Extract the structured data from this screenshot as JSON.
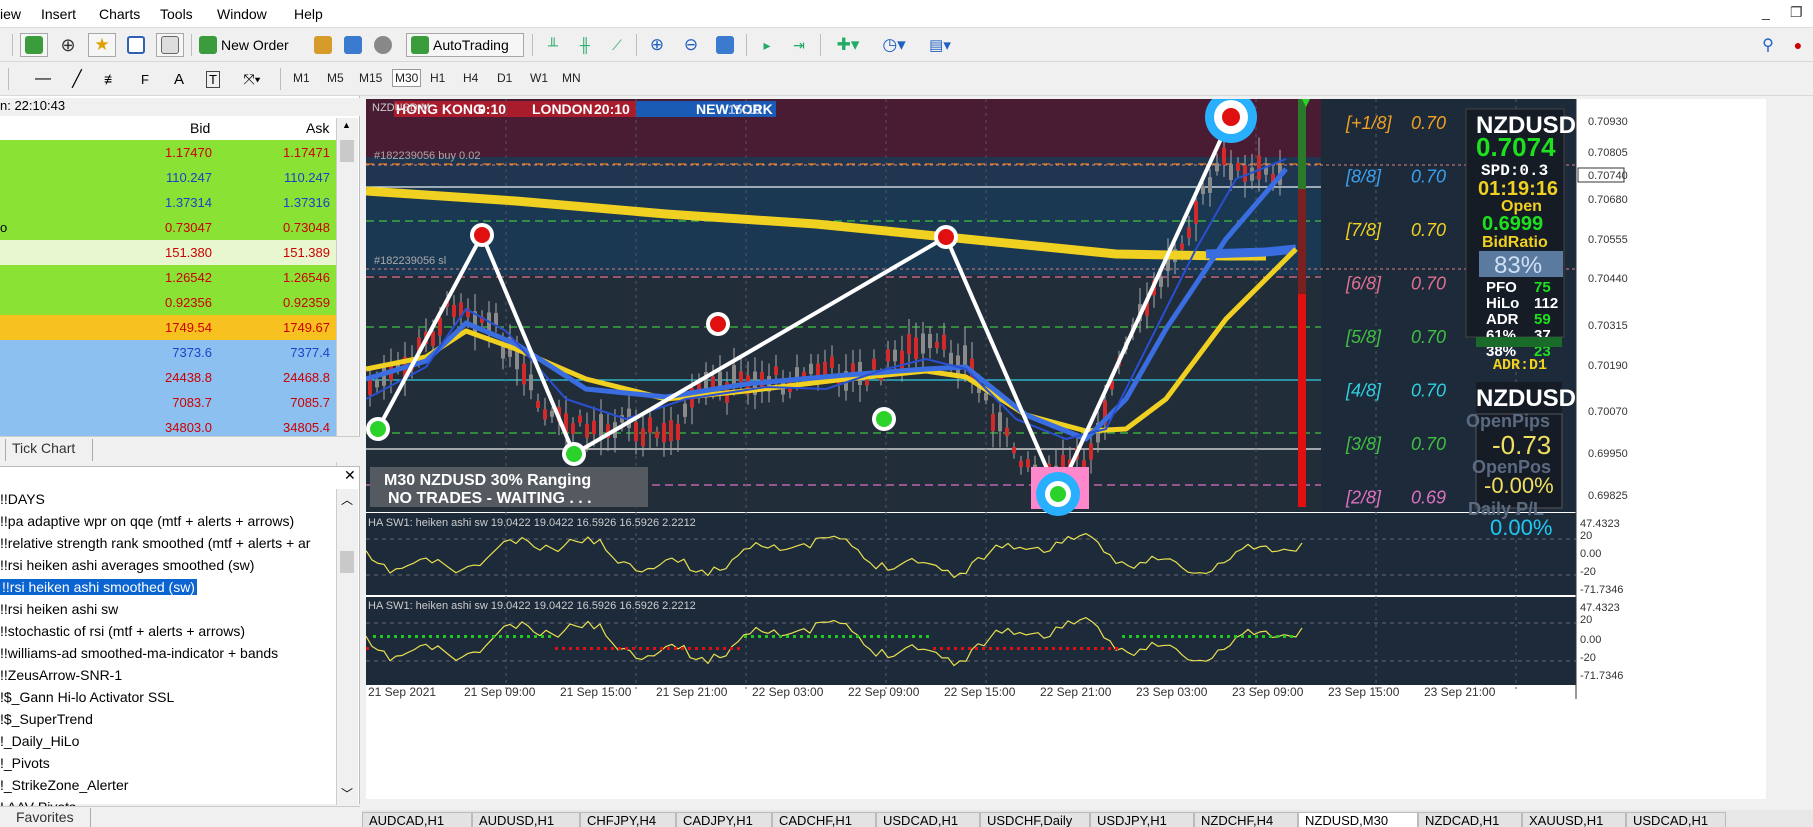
{
  "menu": [
    "iew",
    "Insert",
    "Charts",
    "Tools",
    "Window",
    "Help"
  ],
  "window_controls": [
    "_",
    "❐"
  ],
  "toolbar": {
    "new_order": "New Order",
    "autotrading": "AutoTrading",
    "timeframes": [
      "M1",
      "M5",
      "M15",
      "M30",
      "H1",
      "H4",
      "D1",
      "W1",
      "MN"
    ],
    "active_timeframe": "M30"
  },
  "market_watch": {
    "time": "n: 22:10:43",
    "col_bid": "Bid",
    "col_ask": "Ask",
    "rows": [
      {
        "bid": "1.17470",
        "ask": "1.17471",
        "bg": "#8ae234",
        "color": "#cc0000",
        "prefix": ""
      },
      {
        "bid": "110.247",
        "ask": "110.247",
        "bg": "#8ae234",
        "color": "#1f3fc8",
        "prefix": ""
      },
      {
        "bid": "1.37314",
        "ask": "1.37316",
        "bg": "#8ae234",
        "color": "#1f3fc8",
        "prefix": ""
      },
      {
        "bid": "0.73047",
        "ask": "0.73048",
        "bg": "#8ae234",
        "color": "#cc0000",
        "prefix": "o"
      },
      {
        "bid": "151.380",
        "ask": "151.389",
        "bg": "#e8f7d0",
        "color": "#cc0000",
        "prefix": ""
      },
      {
        "bid": "1.26542",
        "ask": "1.26546",
        "bg": "#8ae234",
        "color": "#cc0000",
        "prefix": ""
      },
      {
        "bid": "0.92356",
        "ask": "0.92359",
        "bg": "#8ae234",
        "color": "#cc0000",
        "prefix": ""
      },
      {
        "bid": "1749.54",
        "ask": "1749.67",
        "bg": "#f7c21f",
        "color": "#cc0000",
        "prefix": ""
      },
      {
        "bid": "7373.6",
        "ask": "7377.4",
        "bg": "#8cc0f0",
        "color": "#1f3fc8",
        "prefix": ""
      },
      {
        "bid": "24438.8",
        "ask": "24468.8",
        "bg": "#8cc0f0",
        "color": "#cc0000",
        "prefix": ""
      },
      {
        "bid": "7083.7",
        "ask": "7085.7",
        "bg": "#8cc0f0",
        "color": "#cc0000",
        "prefix": ""
      },
      {
        "bid": "34803.0",
        "ask": "34805.4",
        "bg": "#8cc0f0",
        "color": "#cc0000",
        "prefix": ""
      }
    ],
    "tab": "Tick Chart"
  },
  "navigator": {
    "items": [
      "!!DAYS",
      "!!pa adaptive wpr on qqe (mtf + alerts + arrows)",
      "!!relative strength rank smoothed (mtf + alerts + ar",
      "!!rsi heiken ashi averages smoothed (sw)",
      "!!rsi heiken ashi smoothed (sw)",
      "!!rsi heiken ashi sw",
      "!!stochastic of rsi  (mtf + alerts + arrows)",
      "!!williams-ad smoothed-ma-indicator + bands",
      "!!ZeusArrow-SNR-1",
      "!$_Gann Hi-lo Activator SSL",
      "!$_SuperTrend",
      "!_Daily_HiLo",
      "!_Pivots",
      "!_StrikeZone_Alerter",
      "! AAV Pivots"
    ],
    "selected_index": 4,
    "favorites": "Favorites"
  },
  "chart": {
    "symbol_label": "NZDUSD,M",
    "sessions": {
      "hk": "HONG KONG",
      "hk_t": "0:10",
      "ldn": "LONDON",
      "ldn_t": "20:10",
      "ny": "NEW YORK",
      "ny_t": "15:10"
    },
    "order_buy": "#182239056 buy 0.02",
    "order_sl": "#182239056 sl",
    "status_1": "M30 NZDUSD 30% Ranging",
    "status_2": "NO TRADES - WAITING . . .",
    "murrey": [
      {
        "label": "[+1/8]",
        "val": "0.70",
        "color": "#f0a020"
      },
      {
        "label": "[8/8]",
        "val": "0.70",
        "color": "#3aa0f0"
      },
      {
        "label": "[7/8]",
        "val": "0.70",
        "color": "#f0d020"
      },
      {
        "label": "[6/8]",
        "val": "0.70",
        "color": "#e07090"
      },
      {
        "label": "[5/8]",
        "val": "0.70",
        "color": "#40c040"
      },
      {
        "label": "[4/8]",
        "val": "0.70",
        "color": "#30d0e0"
      },
      {
        "label": "[3/8]",
        "val": "0.70",
        "color": "#40c040"
      },
      {
        "label": "[2/8]",
        "val": "0.69",
        "color": "#e070c0"
      }
    ],
    "price_axis": [
      "0.70930",
      "0.70805",
      "0.70740",
      "0.70680",
      "0.70555",
      "0.70440",
      "0.70315",
      "0.70190",
      "0.70070",
      "0.69950",
      "0.69825"
    ],
    "current_price": "0.70740",
    "panel": {
      "symbol": "NZDUSD",
      "price": "0.7074",
      "spd": "SPD:0.3",
      "timer": "01:19:16",
      "open_lbl": "Open",
      "open_val": "0.6999",
      "bidratio_lbl": "BidRatio",
      "bidratio": "83%",
      "rows": [
        [
          "PFO",
          "75"
        ],
        [
          "HiLo",
          "112"
        ],
        [
          "ADR",
          "59"
        ],
        [
          "61%",
          "37"
        ],
        [
          "38%",
          "23"
        ]
      ],
      "adr_d1": "ADR:D1",
      "symbol2": "NZDUSD",
      "openpips_lbl": "OpenPips",
      "openpips": "-0.73",
      "openpos_lbl": "OpenPos",
      "openpos": "-0.00%",
      "daily_lbl": "Daily P/L",
      "daily": "0.00%"
    },
    "indicator_label": "HA SW1: heiken ashi sw 19.0422 19.0422 16.5926 16.5926 2.2212",
    "ind_axis": [
      "47.4323",
      "20",
      "0.00",
      "-20",
      "-71.7346"
    ],
    "time_axis": [
      "21 Sep 2021",
      "21 Sep 09:00",
      "21 Sep 15:00",
      "21 Sep 21:00",
      "22 Sep 03:00",
      "22 Sep 09:00",
      "22 Sep 15:00",
      "22 Sep 21:00",
      "23 Sep 03:00",
      "23 Sep 09:00",
      "23 Sep 15:00",
      "23 Sep 21:00"
    ]
  },
  "bottom_tabs": [
    "AUDCAD,H1",
    "AUDUSD,H1",
    "CHFJPY,H4",
    "CADJPY,H1",
    "CADCHF,H1",
    "USDCAD,H1",
    "USDCHF,Daily",
    "USDJPY,H1",
    "NZDCHF,H4",
    "NZDUSD,M30",
    "NZDCAD,H1",
    "XAUUSD,H1",
    "USDCAD,H1"
  ],
  "active_bottom_tab": 9
}
